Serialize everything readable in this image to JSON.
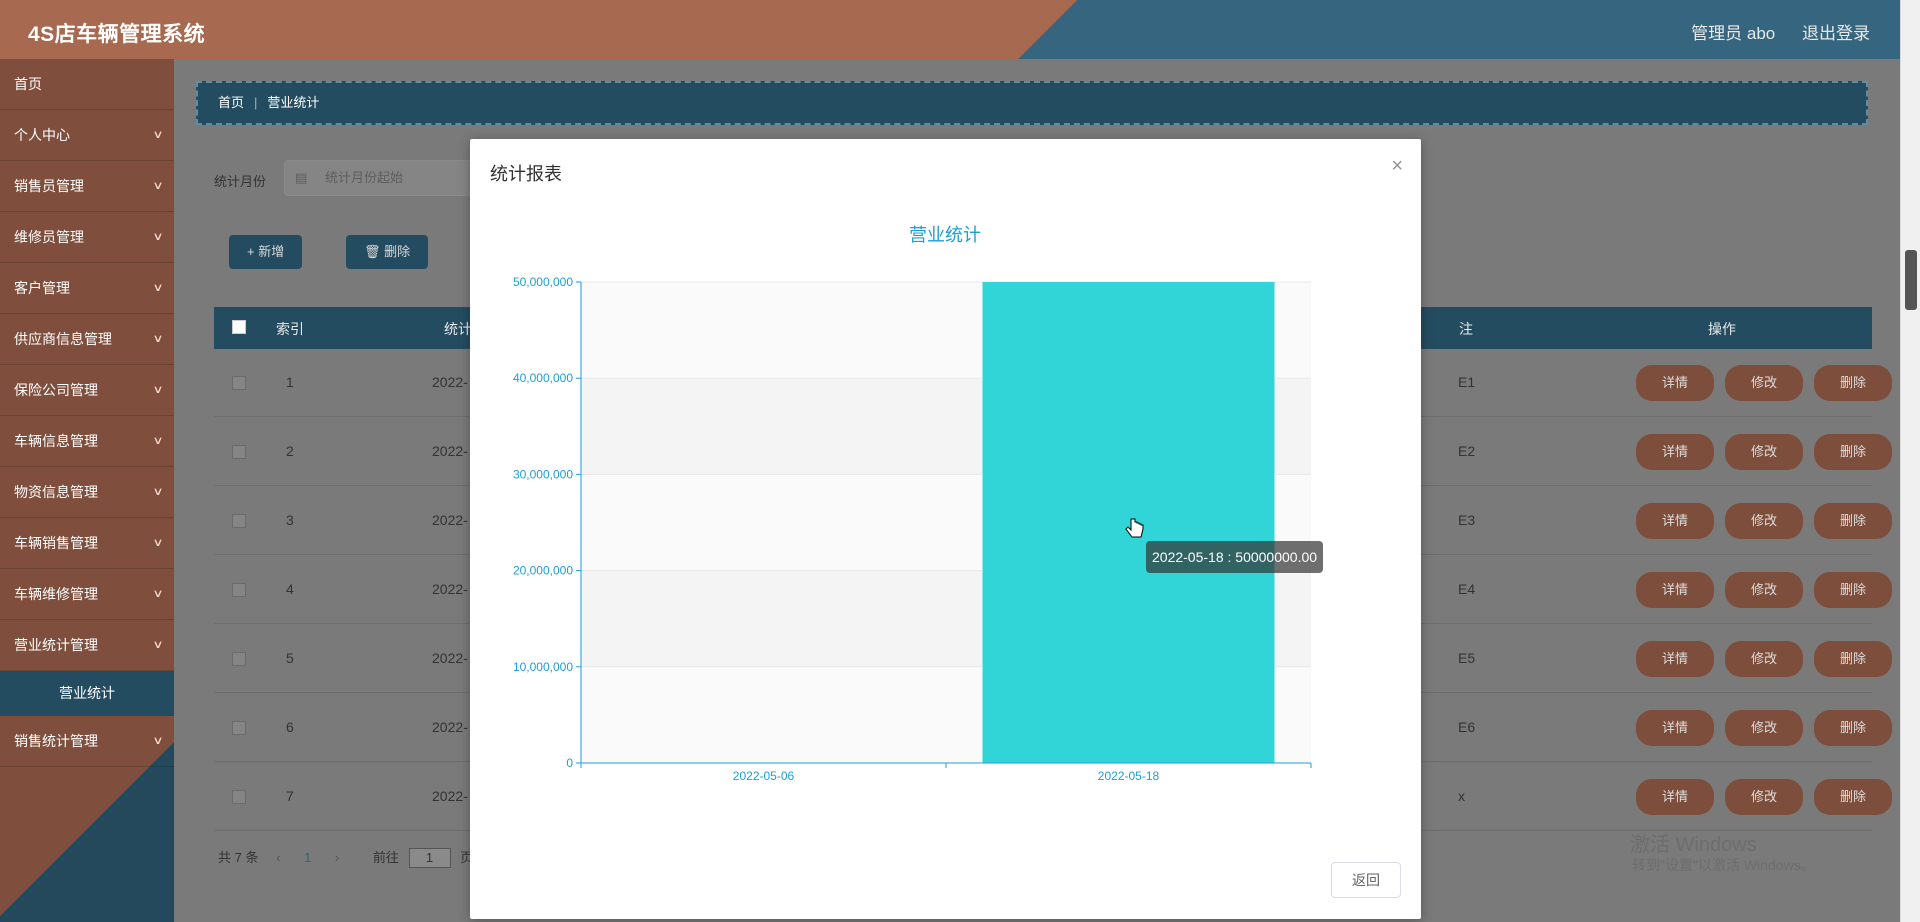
{
  "header": {
    "title": "4S店车辆管理系统",
    "user": "管理员 abo",
    "logout": "退出登录"
  },
  "sidebar": {
    "items": [
      {
        "label": "首页",
        "chevron": false
      },
      {
        "label": "个人中心",
        "chevron": true
      },
      {
        "label": "销售员管理",
        "chevron": true
      },
      {
        "label": "维修员管理",
        "chevron": true
      },
      {
        "label": "客户管理",
        "chevron": true
      },
      {
        "label": "供应商信息管理",
        "chevron": true
      },
      {
        "label": "保险公司管理",
        "chevron": true
      },
      {
        "label": "车辆信息管理",
        "chevron": true
      },
      {
        "label": "物资信息管理",
        "chevron": true
      },
      {
        "label": "车辆销售管理",
        "chevron": true
      },
      {
        "label": "车辆维修管理",
        "chevron": true
      },
      {
        "label": "营业统计管理",
        "chevron": true
      }
    ],
    "active_sub": "营业统计",
    "last_item": "销售统计管理"
  },
  "breadcrumb": {
    "home": "首页",
    "current": "营业统计"
  },
  "filter": {
    "label": "统计月份",
    "placeholder": "统计月份起始"
  },
  "toolbar": {
    "add": "+ 新增",
    "delete": "🗑 删除"
  },
  "table": {
    "headers": {
      "index": "索引",
      "month_partial": "统计",
      "note_partial": "注",
      "ops": "操作"
    },
    "rows": [
      {
        "index": "1",
        "month": "2022-",
        "note": "E1"
      },
      {
        "index": "2",
        "month": "2022-",
        "note": "E2"
      },
      {
        "index": "3",
        "month": "2022-",
        "note": "E3"
      },
      {
        "index": "4",
        "month": "2022-",
        "note": "E4"
      },
      {
        "index": "5",
        "month": "2022-",
        "note": "E5"
      },
      {
        "index": "6",
        "month": "2022-",
        "note": "E6"
      },
      {
        "index": "7",
        "month": "2022-",
        "note": "x"
      }
    ],
    "actions": {
      "detail": "详情",
      "edit": "修改",
      "delete": "删除"
    }
  },
  "pager": {
    "total": "共 7 条",
    "page": "1",
    "goto": "前往",
    "goto_value": "1",
    "page_suffix": "页"
  },
  "watermark": {
    "line1": "激活 Windows",
    "line2": "转到\"设置\"以激活 Windows。"
  },
  "dialog": {
    "title": "统计报表",
    "close": "×",
    "return": "返回"
  },
  "chart_data": {
    "type": "bar",
    "title": "营业统计",
    "categories": [
      "2022-05-06",
      "2022-05-18"
    ],
    "values": [
      0,
      50000000
    ],
    "ylim": [
      0,
      50000000
    ],
    "yticks": [
      0,
      10000000,
      20000000,
      30000000,
      40000000,
      50000000
    ],
    "ytick_labels": [
      "0",
      "10,000,000",
      "20,000,000",
      "30,000,000",
      "40,000,000",
      "50,000,000"
    ],
    "bar_color": "#31d5d8",
    "axis_color": "#1e9fd1",
    "title_color": "#1e9fd1",
    "grid": true,
    "tooltip": "2022-05-18 : 50000000.00"
  }
}
